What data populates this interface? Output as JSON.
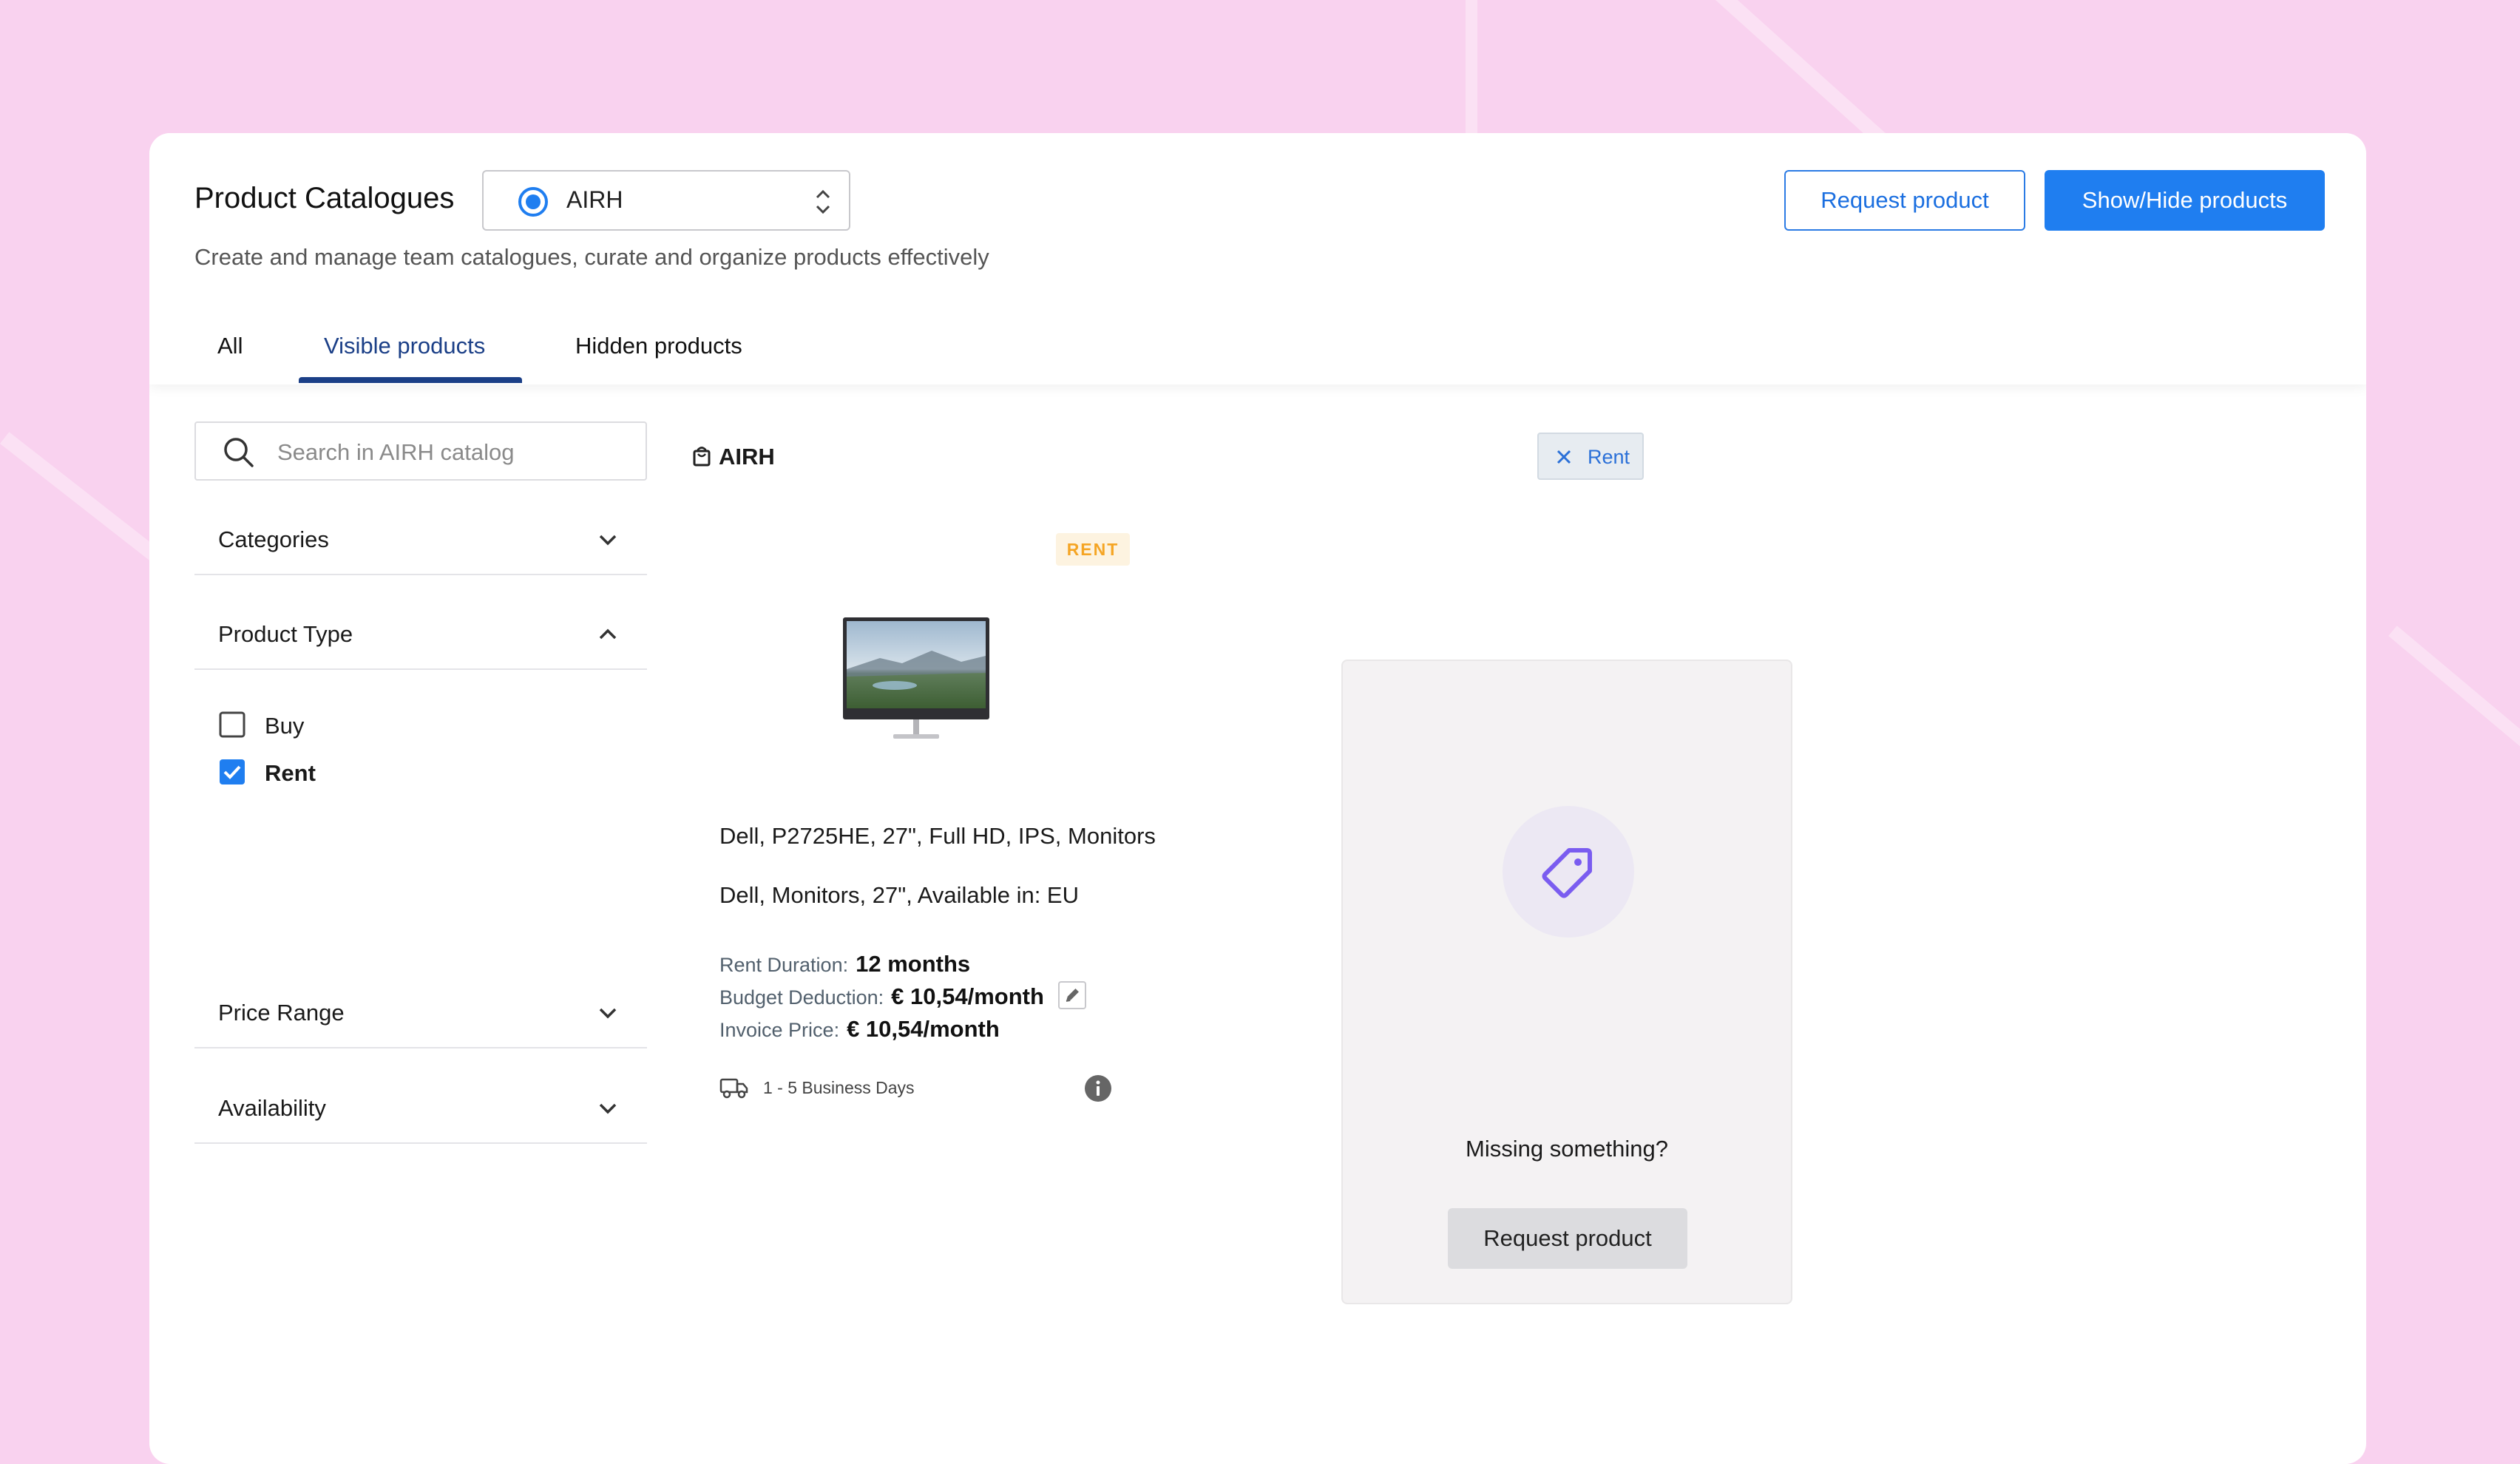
{
  "header": {
    "title": "Product Catalogues",
    "catalog_select_value": "AIRH",
    "subtitle": "Create and manage team catalogues, curate and organize products effectively",
    "request_button": "Request product",
    "show_hide_button": "Show/Hide products"
  },
  "tabs": [
    {
      "label": "All",
      "active": false
    },
    {
      "label": "Visible products",
      "active": true
    },
    {
      "label": "Hidden products",
      "active": false
    }
  ],
  "sidebar": {
    "search_placeholder": "Search in AIRH catalog",
    "filters": {
      "categories": "Categories",
      "product_type": "Product Type",
      "price_range": "Price Range",
      "availability": "Availability"
    },
    "product_type_options": [
      {
        "label": "Buy",
        "checked": false
      },
      {
        "label": "Rent",
        "checked": true
      }
    ]
  },
  "catalog": {
    "name": "AIRH",
    "active_filter_chip": "Rent"
  },
  "product": {
    "badge": "RENT",
    "name": "Dell, P2725HE, 27\", Full HD, IPS, Monitors",
    "description": "Dell, Monitors, 27\", Available in: EU",
    "rent_duration_label": "Rent Duration:",
    "rent_duration_value": "12 months",
    "budget_deduction_label": "Budget Deduction:",
    "budget_deduction_value": "€ 10,54/month",
    "invoice_price_label": "Invoice Price:",
    "invoice_price_value": "€ 10,54/month",
    "delivery": "1 - 5 Business Days"
  },
  "missing_card": {
    "text": "Missing something?",
    "button": "Request product"
  },
  "colors": {
    "background": "#f9d2ef",
    "primary": "#1f7ef0",
    "tab_active": "#1b3f87",
    "badge_text": "#f5a524",
    "tag_icon": "#7a5cf0"
  }
}
